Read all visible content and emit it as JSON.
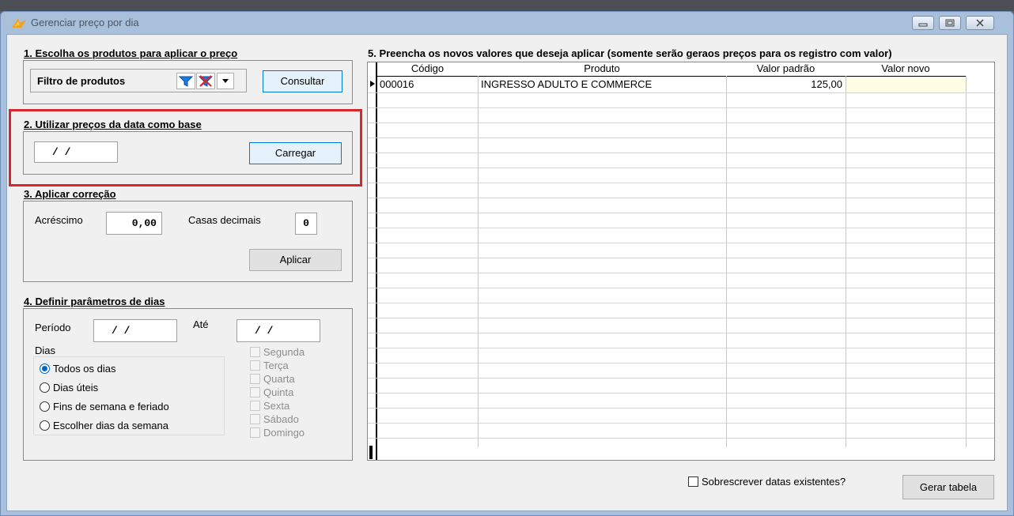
{
  "window": {
    "title": "Gerenciar preço por dia"
  },
  "section1": {
    "title": "1. Escolha os produtos para aplicar o preço",
    "filter_label": "Filtro de produtos",
    "consult_label": "Consultar"
  },
  "section2": {
    "title": "2. Utilizar preços da data como base",
    "date_value": "/  /",
    "load_label": "Carregar"
  },
  "section3": {
    "title": "3. Aplicar correção",
    "increase_label": "Acréscimo",
    "increase_value": "0,00",
    "decimals_label": "Casas decimais",
    "decimals_value": "0",
    "apply_label": "Aplicar"
  },
  "section4": {
    "title": "4. Definir parâmetros de dias",
    "period_label": "Período",
    "period_value": "/  /",
    "until_label": "Até",
    "until_value": "/  /",
    "days_label": "Dias",
    "radio_options": [
      "Todos os dias",
      "Dias úteis",
      "Fins de semana e feriado",
      "Escolher dias da semana"
    ],
    "selected_option": "Todos os dias",
    "weekdays": [
      "Segunda",
      "Terça",
      "Quarta",
      "Quinta",
      "Sexta",
      "Sábado",
      "Domingo"
    ]
  },
  "section5": {
    "title": "5. Preencha os novos valores que deseja aplicar (somente serão geraos preços para os registro com valor)",
    "columns": [
      "Código",
      "Produto",
      "Valor padrão",
      "Valor novo"
    ],
    "rows": [
      {
        "codigo": "000016",
        "produto": "INGRESSO ADULTO E COMMERCE",
        "valor_padrao": "125,00",
        "valor_novo": ""
      }
    ]
  },
  "footer": {
    "overwrite_label": "Sobrescrever datas existentes?",
    "generate_label": "Gerar tabela"
  },
  "colors": {
    "highlight_box": "#d9262b",
    "new_value_cell": "#fffde6",
    "radio_selected": "#0067c0"
  }
}
